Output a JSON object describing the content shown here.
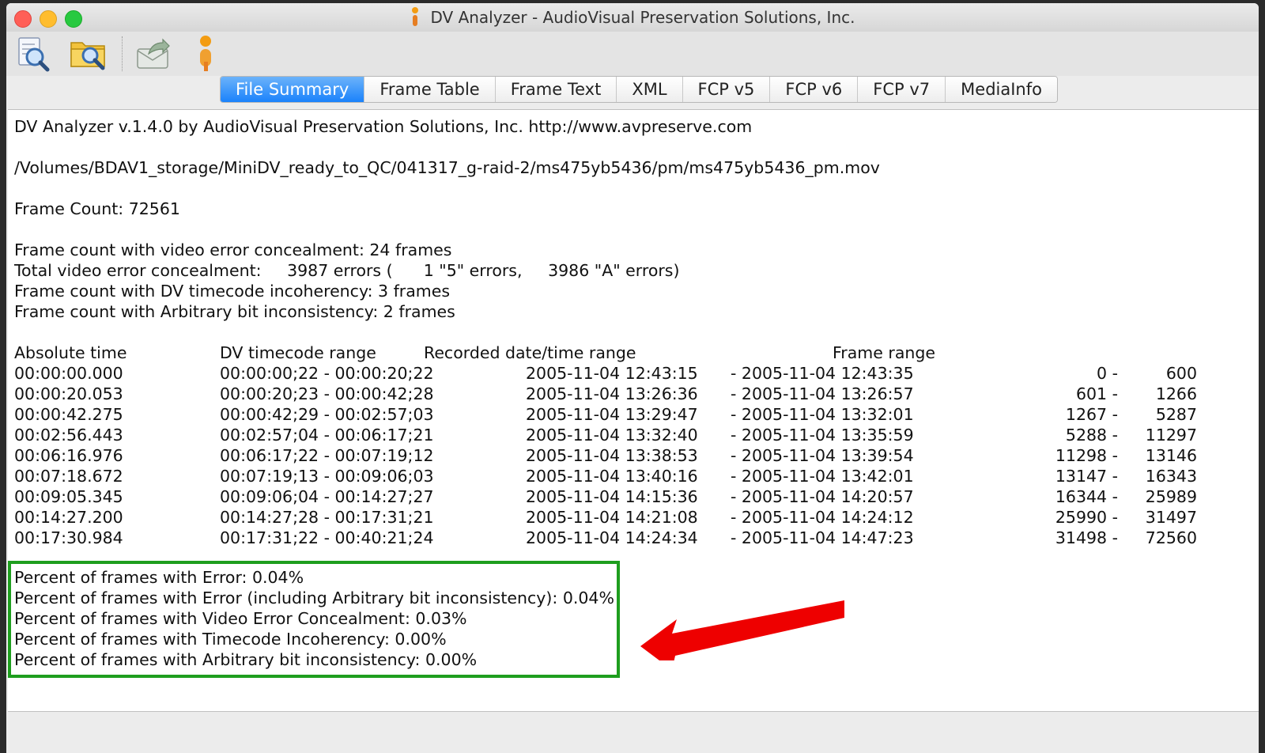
{
  "window": {
    "title": "DV Analyzer - AudioVisual Preservation Solutions, Inc."
  },
  "toolbar": {
    "buttons": [
      {
        "name": "open-file-icon"
      },
      {
        "name": "open-folder-icon"
      },
      {
        "name": "export-icon"
      },
      {
        "name": "avps-logo-icon"
      }
    ]
  },
  "tabs": [
    {
      "label": "File Summary",
      "active": true
    },
    {
      "label": "Frame Table",
      "active": false
    },
    {
      "label": "Frame Text",
      "active": false
    },
    {
      "label": "XML",
      "active": false
    },
    {
      "label": "FCP v5",
      "active": false
    },
    {
      "label": "FCP v6",
      "active": false
    },
    {
      "label": "FCP v7",
      "active": false
    },
    {
      "label": "MediaInfo",
      "active": false
    }
  ],
  "summary": {
    "header": "DV Analyzer v.1.4.0 by AudioVisual Preservation Solutions, Inc. http://www.avpreserve.com",
    "file_path": "/Volumes/BDAV1_storage/MiniDV_ready_to_QC/041317_g-raid-2/ms475yb5436/pm/ms475yb5436_pm.mov",
    "frame_count": "Frame Count: 72561",
    "stats": [
      "Frame count with video error concealment: 24 frames",
      "Total video error concealment:     3987 errors (      1 \"5\" errors,     3986 \"A\" errors)",
      "Frame count with DV timecode incoherency: 3 frames",
      "Frame count with Arbitrary bit inconsistency: 2 frames"
    ],
    "table": {
      "headers": [
        "Absolute time",
        "DV timecode range",
        "Recorded date/time range",
        "Frame range"
      ],
      "rows": [
        {
          "abs": "00:00:00.000",
          "tc": "00:00:00;22 - 00:00:20;22",
          "rec_start": "2005-11-04 12:43:15",
          "rec_end": "- 2005-11-04 12:43:35",
          "f_start": "0 -",
          "f_end": "600"
        },
        {
          "abs": "00:00:20.053",
          "tc": "00:00:20;23 - 00:00:42;28",
          "rec_start": "2005-11-04 13:26:36",
          "rec_end": "- 2005-11-04 13:26:57",
          "f_start": "601 -",
          "f_end": "1266"
        },
        {
          "abs": "00:00:42.275",
          "tc": "00:00:42;29 - 00:02:57;03",
          "rec_start": "2005-11-04 13:29:47",
          "rec_end": "- 2005-11-04 13:32:01",
          "f_start": "1267 -",
          "f_end": "5287"
        },
        {
          "abs": "00:02:56.443",
          "tc": "00:02:57;04 - 00:06:17;21",
          "rec_start": "2005-11-04 13:32:40",
          "rec_end": "- 2005-11-04 13:35:59",
          "f_start": "5288 -",
          "f_end": "11297"
        },
        {
          "abs": "00:06:16.976",
          "tc": "00:06:17;22 - 00:07:19;12",
          "rec_start": "2005-11-04 13:38:53",
          "rec_end": "- 2005-11-04 13:39:54",
          "f_start": "11298 -",
          "f_end": "13146"
        },
        {
          "abs": "00:07:18.672",
          "tc": "00:07:19;13 - 00:09:06;03",
          "rec_start": "2005-11-04 13:40:16",
          "rec_end": "- 2005-11-04 13:42:01",
          "f_start": "13147 -",
          "f_end": "16343"
        },
        {
          "abs": "00:09:05.345",
          "tc": "00:09:06;04 - 00:14:27;27",
          "rec_start": "2005-11-04 14:15:36",
          "rec_end": "- 2005-11-04 14:20:57",
          "f_start": "16344 -",
          "f_end": "25989"
        },
        {
          "abs": "00:14:27.200",
          "tc": "00:14:27;28 - 00:17:31;21",
          "rec_start": "2005-11-04 14:21:08",
          "rec_end": "- 2005-11-04 14:24:12",
          "f_start": "25990 -",
          "f_end": "31497"
        },
        {
          "abs": "00:17:30.984",
          "tc": "00:17:31;22 - 00:40:21;24",
          "rec_start": "2005-11-04 14:24:34",
          "rec_end": "- 2005-11-04 14:47:23",
          "f_start": "31498 -",
          "f_end": "72560"
        }
      ]
    },
    "percentages": [
      "Percent of frames with Error: 0.04%",
      "Percent of frames with Error (including Arbitrary bit inconsistency): 0.04%",
      "Percent of frames with Video Error Concealment: 0.03%",
      "Percent of frames with Timecode Incoherency: 0.00%",
      "Percent of frames with Arbitrary bit inconsistency: 0.00%"
    ]
  },
  "colors": {
    "highlight_box": "#1e9e1e",
    "annotation_arrow": "#ee0000",
    "active_tab": "#1a82fb"
  }
}
